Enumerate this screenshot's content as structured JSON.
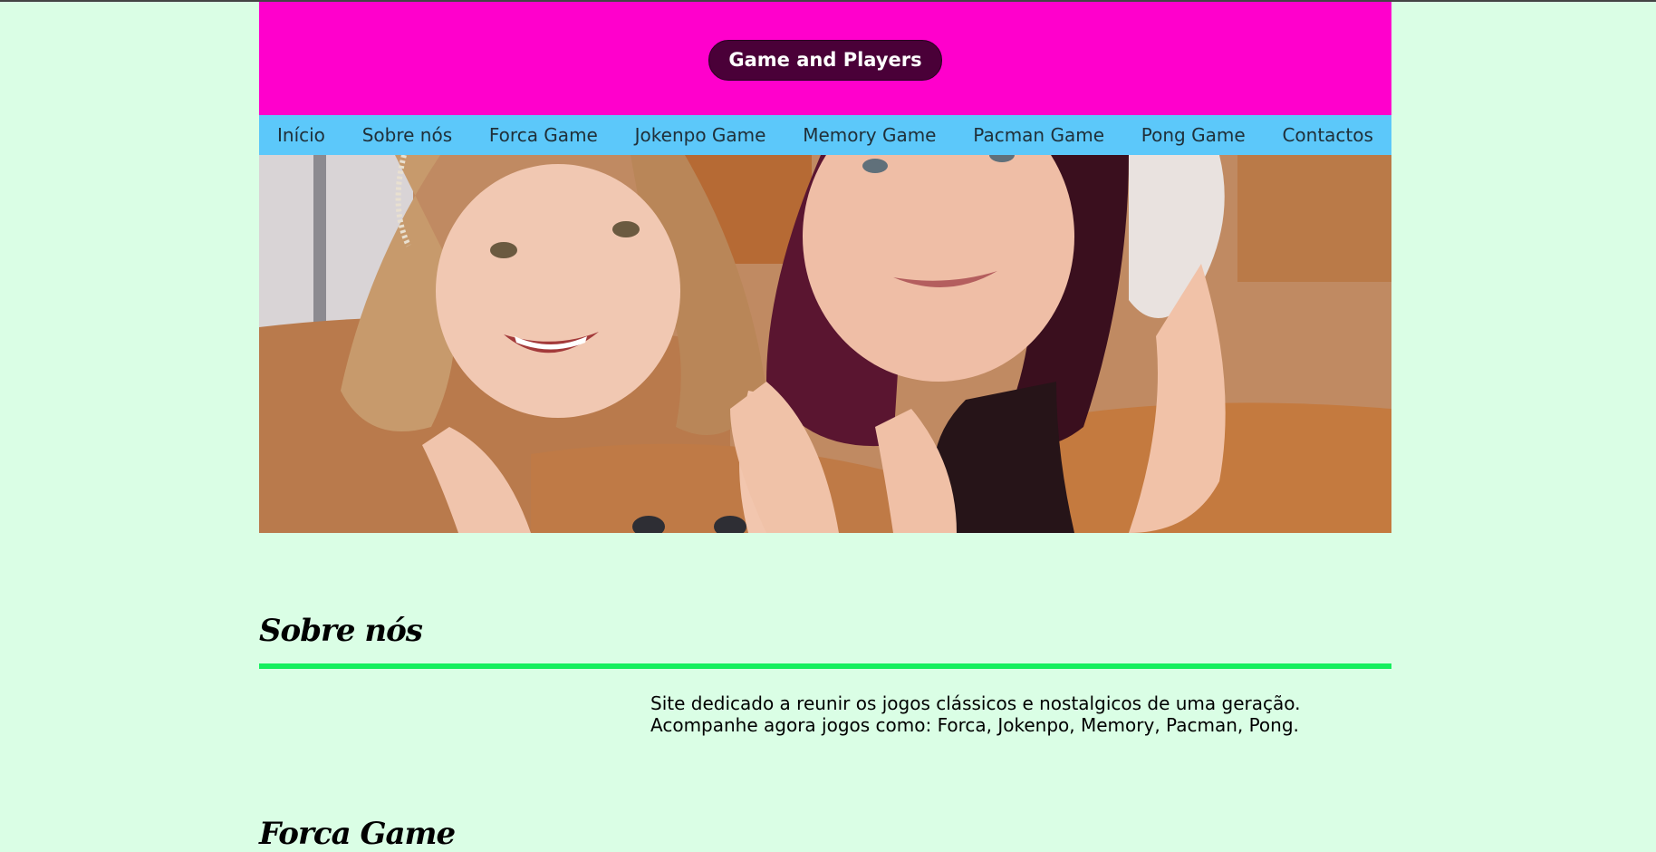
{
  "header": {
    "title": "Game and Players"
  },
  "nav": {
    "items": [
      {
        "label": "Início"
      },
      {
        "label": "Sobre nós"
      },
      {
        "label": "Forca Game"
      },
      {
        "label": "Jokenpo Game"
      },
      {
        "label": "Memory Game"
      },
      {
        "label": "Pacman Game"
      },
      {
        "label": "Pong Game"
      },
      {
        "label": "Contactos"
      }
    ]
  },
  "hero": {
    "image": "photo of girl and woman lying down holding game controllers"
  },
  "about": {
    "title": "Sobre nós",
    "line1": "Site dedicado a reunir os jogos clássicos e nostalgicos de uma geração.",
    "line2": "Acompanhe agora jogos como: Forca, Jokenpo, Memory, Pacman, Pong."
  },
  "forca": {
    "title": "Forca Game"
  },
  "colors": {
    "background": "#dafee5",
    "header": "#ff00cc",
    "brand_pill": "#4a0038",
    "nav": "#5cc8fa",
    "rule": "#16ef5e"
  }
}
